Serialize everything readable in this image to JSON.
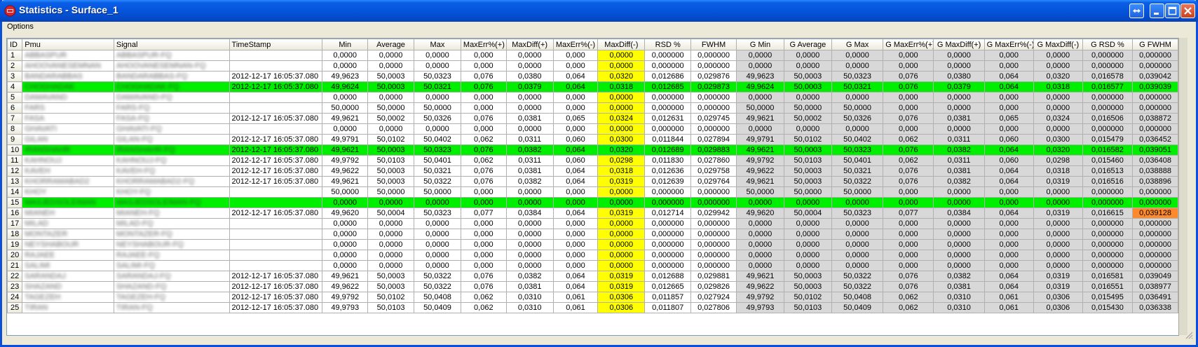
{
  "window": {
    "title": "Statistics - Surface_1",
    "buttons": {
      "restore_icon": "restore-arrows-icon",
      "minimize_icon": "minimize-icon",
      "maximize_icon": "maximize-icon",
      "close_icon": "close-icon"
    }
  },
  "menu": {
    "options_label": "Options"
  },
  "colors": {
    "highlight_row": "#00EE00",
    "maxdiff_minus_column": "#FFFF00",
    "g_columns": "#D8D8D8",
    "alert_cell": "#FF8A2B",
    "title_bar": "#0553D8"
  },
  "table": {
    "columns": [
      "ID",
      "Pmu",
      "Signal",
      "TimeStamp",
      "Min",
      "Average",
      "Max",
      "MaxErr%(+)",
      "MaxDiff(+)",
      "MaxErr%(-)",
      "MaxDiff(-)",
      "RSD %",
      "FWHM",
      "G Min",
      "G Average",
      "G Max",
      "G MaxErr%(+)",
      "G MaxDiff(+)",
      "G MaxErr%(-)",
      "G MaxDiff(-)",
      "G RSD %",
      "G FWHM"
    ],
    "rows": [
      {
        "id": "1",
        "pmu": "ABBASPUR",
        "signal": "ABBASPUR-FQ",
        "ts": "",
        "highlight": false,
        "v": [
          "0,0000",
          "0,0000",
          "0,0000",
          "0,000",
          "0,0000",
          "0,000",
          "0,0000",
          "0,000000",
          "0,000000",
          "0,0000",
          "0,0000",
          "0,0000",
          "0,000",
          "0,0000",
          "0,000",
          "0,0000",
          "0,000000",
          "0,000000"
        ]
      },
      {
        "id": "2",
        "pmu": "AHOOVANESEMNAN",
        "signal": "AHOOVANESEMNAN-FQ",
        "ts": "",
        "highlight": false,
        "v": [
          "0,0000",
          "0,0000",
          "0,0000",
          "0,000",
          "0,0000",
          "0,000",
          "0,0000",
          "0,000000",
          "0,000000",
          "0,0000",
          "0,0000",
          "0,0000",
          "0,000",
          "0,0000",
          "0,000",
          "0,0000",
          "0,000000",
          "0,000000"
        ]
      },
      {
        "id": "3",
        "pmu": "BANDARABBAS",
        "signal": "BANDARABBAS-FQ",
        "ts": "2012-12-17 16:05:37.080",
        "highlight": false,
        "v": [
          "49,9623",
          "50,0003",
          "50,0323",
          "0,076",
          "0,0380",
          "0,064",
          "0,0320",
          "0,012686",
          "0,029876",
          "49,9623",
          "50,0003",
          "50,0323",
          "0,076",
          "0,0380",
          "0,064",
          "0,0320",
          "0,016578",
          "0,039042"
        ]
      },
      {
        "id": "4",
        "pmu": "CHOGHADAK",
        "signal": "CHOGHADAK-FQ",
        "ts": "2012-12-17 16:05:37.080",
        "highlight": true,
        "v": [
          "49,9624",
          "50,0003",
          "50,0321",
          "0,076",
          "0,0379",
          "0,064",
          "0,0318",
          "0,012685",
          "0,029873",
          "49,9624",
          "50,0003",
          "50,0321",
          "0,076",
          "0,0379",
          "0,064",
          "0,0318",
          "0,016577",
          "0,039039"
        ]
      },
      {
        "id": "5",
        "pmu": "DAMAVAND",
        "signal": "DAMAVAND-FQ",
        "ts": "",
        "highlight": false,
        "v": [
          "0,0000",
          "0,0000",
          "0,0000",
          "0,000",
          "0,0000",
          "0,000",
          "0,0000",
          "0,000000",
          "0,000000",
          "0,0000",
          "0,0000",
          "0,0000",
          "0,000",
          "0,0000",
          "0,000",
          "0,0000",
          "0,000000",
          "0,000000"
        ]
      },
      {
        "id": "6",
        "pmu": "FARS",
        "signal": "FARS-FQ",
        "ts": "",
        "highlight": false,
        "v": [
          "50,0000",
          "50,0000",
          "50,0000",
          "0,000",
          "0,0000",
          "0,000",
          "0,0000",
          "0,000000",
          "0,000000",
          "50,0000",
          "50,0000",
          "50,0000",
          "0,000",
          "0,0000",
          "0,000",
          "0,0000",
          "0,000000",
          "0,000000"
        ]
      },
      {
        "id": "7",
        "pmu": "FASA",
        "signal": "FASA-FQ",
        "ts": "2012-12-17 16:05:37.080",
        "highlight": false,
        "v": [
          "49,9621",
          "50,0002",
          "50,0326",
          "0,076",
          "0,0381",
          "0,065",
          "0,0324",
          "0,012631",
          "0,029745",
          "49,9621",
          "50,0002",
          "50,0326",
          "0,076",
          "0,0381",
          "0,065",
          "0,0324",
          "0,016506",
          "0,038872"
        ]
      },
      {
        "id": "8",
        "pmu": "GHAVATI",
        "signal": "GHAVATI-FQ",
        "ts": "",
        "highlight": false,
        "v": [
          "0,0000",
          "0,0000",
          "0,0000",
          "0,000",
          "0,0000",
          "0,000",
          "0,0000",
          "0,000000",
          "0,000000",
          "0,0000",
          "0,0000",
          "0,0000",
          "0,000",
          "0,0000",
          "0,000",
          "0,0000",
          "0,000000",
          "0,000000"
        ]
      },
      {
        "id": "9",
        "pmu": "GILAN",
        "signal": "GILAN-FQ",
        "ts": "2012-12-17 16:05:37.080",
        "highlight": false,
        "v": [
          "49,9791",
          "50,0102",
          "50,0402",
          "0,062",
          "0,0311",
          "0,060",
          "0,0300",
          "0,011844",
          "0,027894",
          "49,9791",
          "50,0102",
          "50,0402",
          "0,062",
          "0,0311",
          "0,060",
          "0,0300",
          "0,015479",
          "0,036452"
        ]
      },
      {
        "id": "10",
        "pmu": "IRANSHAHR",
        "signal": "IRANSHAHR-FQ",
        "ts": "2012-12-17 16:05:37.080",
        "highlight": true,
        "v": [
          "49,9621",
          "50,0003",
          "50,0323",
          "0,076",
          "0,0382",
          "0,064",
          "0,0320",
          "0,012689",
          "0,029883",
          "49,9621",
          "50,0003",
          "50,0323",
          "0,076",
          "0,0382",
          "0,064",
          "0,0320",
          "0,016582",
          "0,039051"
        ]
      },
      {
        "id": "11",
        "pmu": "KAHNOUJ",
        "signal": "KAHNOUJ-FQ",
        "ts": "2012-12-17 16:05:37.080",
        "highlight": false,
        "v": [
          "49,9792",
          "50,0103",
          "50,0401",
          "0,062",
          "0,0311",
          "0,060",
          "0,0298",
          "0,011830",
          "0,027860",
          "49,9792",
          "50,0103",
          "50,0401",
          "0,062",
          "0,0311",
          "0,060",
          "0,0298",
          "0,015460",
          "0,036408"
        ]
      },
      {
        "id": "12",
        "pmu": "KAVEH",
        "signal": "KAVEH-FQ",
        "ts": "2012-12-17 16:05:37.080",
        "highlight": false,
        "v": [
          "49,9622",
          "50,0003",
          "50,0321",
          "0,076",
          "0,0381",
          "0,064",
          "0,0318",
          "0,012636",
          "0,029758",
          "49,9622",
          "50,0003",
          "50,0321",
          "0,076",
          "0,0381",
          "0,064",
          "0,0318",
          "0,016513",
          "0,038888"
        ]
      },
      {
        "id": "13",
        "pmu": "KHORRAMABAD2",
        "signal": "KHORRAMABAD2-FQ",
        "ts": "2012-12-17 16:05:37.080",
        "highlight": false,
        "v": [
          "49,9621",
          "50,0003",
          "50,0322",
          "0,076",
          "0,0382",
          "0,064",
          "0,0319",
          "0,012639",
          "0,029764",
          "49,9621",
          "50,0003",
          "50,0322",
          "0,076",
          "0,0382",
          "0,064",
          "0,0319",
          "0,016516",
          "0,038896"
        ]
      },
      {
        "id": "14",
        "pmu": "KHOY",
        "signal": "KHOY-FQ",
        "ts": "",
        "highlight": false,
        "v": [
          "50,0000",
          "50,0000",
          "50,0000",
          "0,000",
          "0,0000",
          "0,000",
          "0,0000",
          "0,000000",
          "0,000000",
          "50,0000",
          "50,0000",
          "50,0000",
          "0,000",
          "0,0000",
          "0,000",
          "0,0000",
          "0,000000",
          "0,000000"
        ]
      },
      {
        "id": "15",
        "pmu": "MASJEDSOLEIMAN",
        "signal": "MASJEDSOLEIMAN-FQ",
        "ts": "",
        "highlight": true,
        "v": [
          "0,0000",
          "0,0000",
          "0,0000",
          "0,000",
          "0,0000",
          "0,000",
          "0,0000",
          "0,000000",
          "0,000000",
          "0,0000",
          "0,0000",
          "0,0000",
          "0,000",
          "0,0000",
          "0,000",
          "0,0000",
          "0,000000",
          "0,000000"
        ]
      },
      {
        "id": "16",
        "pmu": "MIANEH",
        "signal": "MIANEH-FQ",
        "ts": "2012-12-17 16:05:37.080",
        "highlight": false,
        "alert_last": true,
        "v": [
          "49,9620",
          "50,0004",
          "50,0323",
          "0,077",
          "0,0384",
          "0,064",
          "0,0319",
          "0,012714",
          "0,029942",
          "49,9620",
          "50,0004",
          "50,0323",
          "0,077",
          "0,0384",
          "0,064",
          "0,0319",
          "0,016615",
          "0,039128"
        ]
      },
      {
        "id": "17",
        "pmu": "MILAD",
        "signal": "MILAD-FQ",
        "ts": "",
        "highlight": false,
        "v": [
          "0,0000",
          "0,0000",
          "0,0000",
          "0,000",
          "0,0000",
          "0,000",
          "0,0000",
          "0,000000",
          "0,000000",
          "0,0000",
          "0,0000",
          "0,0000",
          "0,000",
          "0,0000",
          "0,000",
          "0,0000",
          "0,000000",
          "0,000000"
        ]
      },
      {
        "id": "18",
        "pmu": "MONTAZER",
        "signal": "MONTAZER-FQ",
        "ts": "",
        "highlight": false,
        "v": [
          "0,0000",
          "0,0000",
          "0,0000",
          "0,000",
          "0,0000",
          "0,000",
          "0,0000",
          "0,000000",
          "0,000000",
          "0,0000",
          "0,0000",
          "0,0000",
          "0,000",
          "0,0000",
          "0,000",
          "0,0000",
          "0,000000",
          "0,000000"
        ]
      },
      {
        "id": "19",
        "pmu": "NEYSHABOUR",
        "signal": "NEYSHABOUR-FQ",
        "ts": "",
        "highlight": false,
        "v": [
          "0,0000",
          "0,0000",
          "0,0000",
          "0,000",
          "0,0000",
          "0,000",
          "0,0000",
          "0,000000",
          "0,000000",
          "0,0000",
          "0,0000",
          "0,0000",
          "0,000",
          "0,0000",
          "0,000",
          "0,0000",
          "0,000000",
          "0,000000"
        ]
      },
      {
        "id": "20",
        "pmu": "RAJAEE",
        "signal": "RAJAEE-FQ",
        "ts": "",
        "highlight": false,
        "v": [
          "0,0000",
          "0,0000",
          "0,0000",
          "0,000",
          "0,0000",
          "0,000",
          "0,0000",
          "0,000000",
          "0,000000",
          "0,0000",
          "0,0000",
          "0,0000",
          "0,000",
          "0,0000",
          "0,000",
          "0,0000",
          "0,000000",
          "0,000000"
        ]
      },
      {
        "id": "21",
        "pmu": "SALIMI",
        "signal": "SALIMI-FQ",
        "ts": "",
        "highlight": false,
        "v": [
          "0,0000",
          "0,0000",
          "0,0000",
          "0,000",
          "0,0000",
          "0,000",
          "0,0000",
          "0,000000",
          "0,000000",
          "0,0000",
          "0,0000",
          "0,0000",
          "0,000",
          "0,0000",
          "0,000",
          "0,0000",
          "0,000000",
          "0,000000"
        ]
      },
      {
        "id": "22",
        "pmu": "SARANDAJ",
        "signal": "SARANDAJ-FQ",
        "ts": "2012-12-17 16:05:37.080",
        "highlight": false,
        "v": [
          "49,9621",
          "50,0003",
          "50,0322",
          "0,076",
          "0,0382",
          "0,064",
          "0,0319",
          "0,012688",
          "0,029881",
          "49,9621",
          "50,0003",
          "50,0322",
          "0,076",
          "0,0382",
          "0,064",
          "0,0319",
          "0,016581",
          "0,039049"
        ]
      },
      {
        "id": "23",
        "pmu": "SHAZAND",
        "signal": "SHAZAND-FQ",
        "ts": "2012-12-17 16:05:37.080",
        "highlight": false,
        "v": [
          "49,9622",
          "50,0003",
          "50,0322",
          "0,076",
          "0,0381",
          "0,064",
          "0,0319",
          "0,012665",
          "0,029826",
          "49,9622",
          "50,0003",
          "50,0322",
          "0,076",
          "0,0381",
          "0,064",
          "0,0319",
          "0,016551",
          "0,038977"
        ]
      },
      {
        "id": "24",
        "pmu": "TAGEZEH",
        "signal": "TAGEZEH-FQ",
        "ts": "2012-12-17 16:05:37.080",
        "highlight": false,
        "v": [
          "49,9792",
          "50,0102",
          "50,0408",
          "0,062",
          "0,0310",
          "0,061",
          "0,0306",
          "0,011857",
          "0,027924",
          "49,9792",
          "50,0102",
          "50,0408",
          "0,062",
          "0,0310",
          "0,061",
          "0,0306",
          "0,015495",
          "0,036491"
        ]
      },
      {
        "id": "25",
        "pmu": "TIRAN",
        "signal": "TIRAN-FQ",
        "ts": "2012-12-17 16:05:37.080",
        "highlight": false,
        "v": [
          "49,9793",
          "50,0103",
          "50,0409",
          "0,062",
          "0,0310",
          "0,061",
          "0,0306",
          "0,011807",
          "0,027806",
          "49,9793",
          "50,0103",
          "50,0409",
          "0,062",
          "0,0310",
          "0,061",
          "0,0306",
          "0,015430",
          "0,036338"
        ]
      }
    ]
  }
}
